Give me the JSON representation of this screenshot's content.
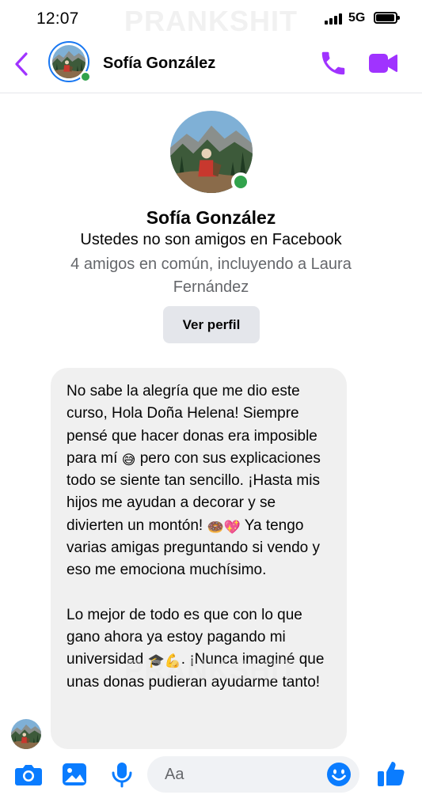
{
  "status_bar": {
    "time": "12:07",
    "network": "5G",
    "watermark": "PRANKSHIT"
  },
  "header": {
    "contact_name": "Sofía González",
    "online": true
  },
  "profile": {
    "name": "Sofía González",
    "relation": "Ustedes no son amigos en Facebook",
    "mutual": "4 amigos en común, incluyendo a Laura Fernández",
    "view_profile_button": "Ver perfil"
  },
  "message": {
    "p1_a": "No sabe la alegría que me dio este curso, Hola Doña Helena! Siempre pensé que hacer donas era imposible para mí ",
    "p1_emoji1": "😅",
    "p1_b": " pero con sus explicaciones todo se siente tan sencillo. ¡Hasta mis hijos me ayudan a decorar y se divierten un montón! ",
    "p1_emoji2": "🍩💖",
    "p1_c": " Ya tengo varias amigas preguntando si vendo y eso me emociona muchísimo.",
    "p2_a": "Lo mejor de todo es que con lo que gano ahora ya estoy pagando mi universidad ",
    "p2_emoji": "🎓💪",
    "p2_b": ". ¡Nunca imaginé que unas donas pudieran ayudarme tanto!"
  },
  "composer": {
    "placeholder": "Aa"
  },
  "colors": {
    "messenger_purple": "#a033ff",
    "accent_blue": "#0a7cff",
    "online_green": "#31a24c",
    "bubble_gray": "#f0f0f0"
  },
  "icons": [
    "back-chevron-icon",
    "phone-icon",
    "video-camera-icon",
    "camera-icon",
    "photo-icon",
    "microphone-icon",
    "smiley-icon",
    "thumbs-up-icon"
  ]
}
